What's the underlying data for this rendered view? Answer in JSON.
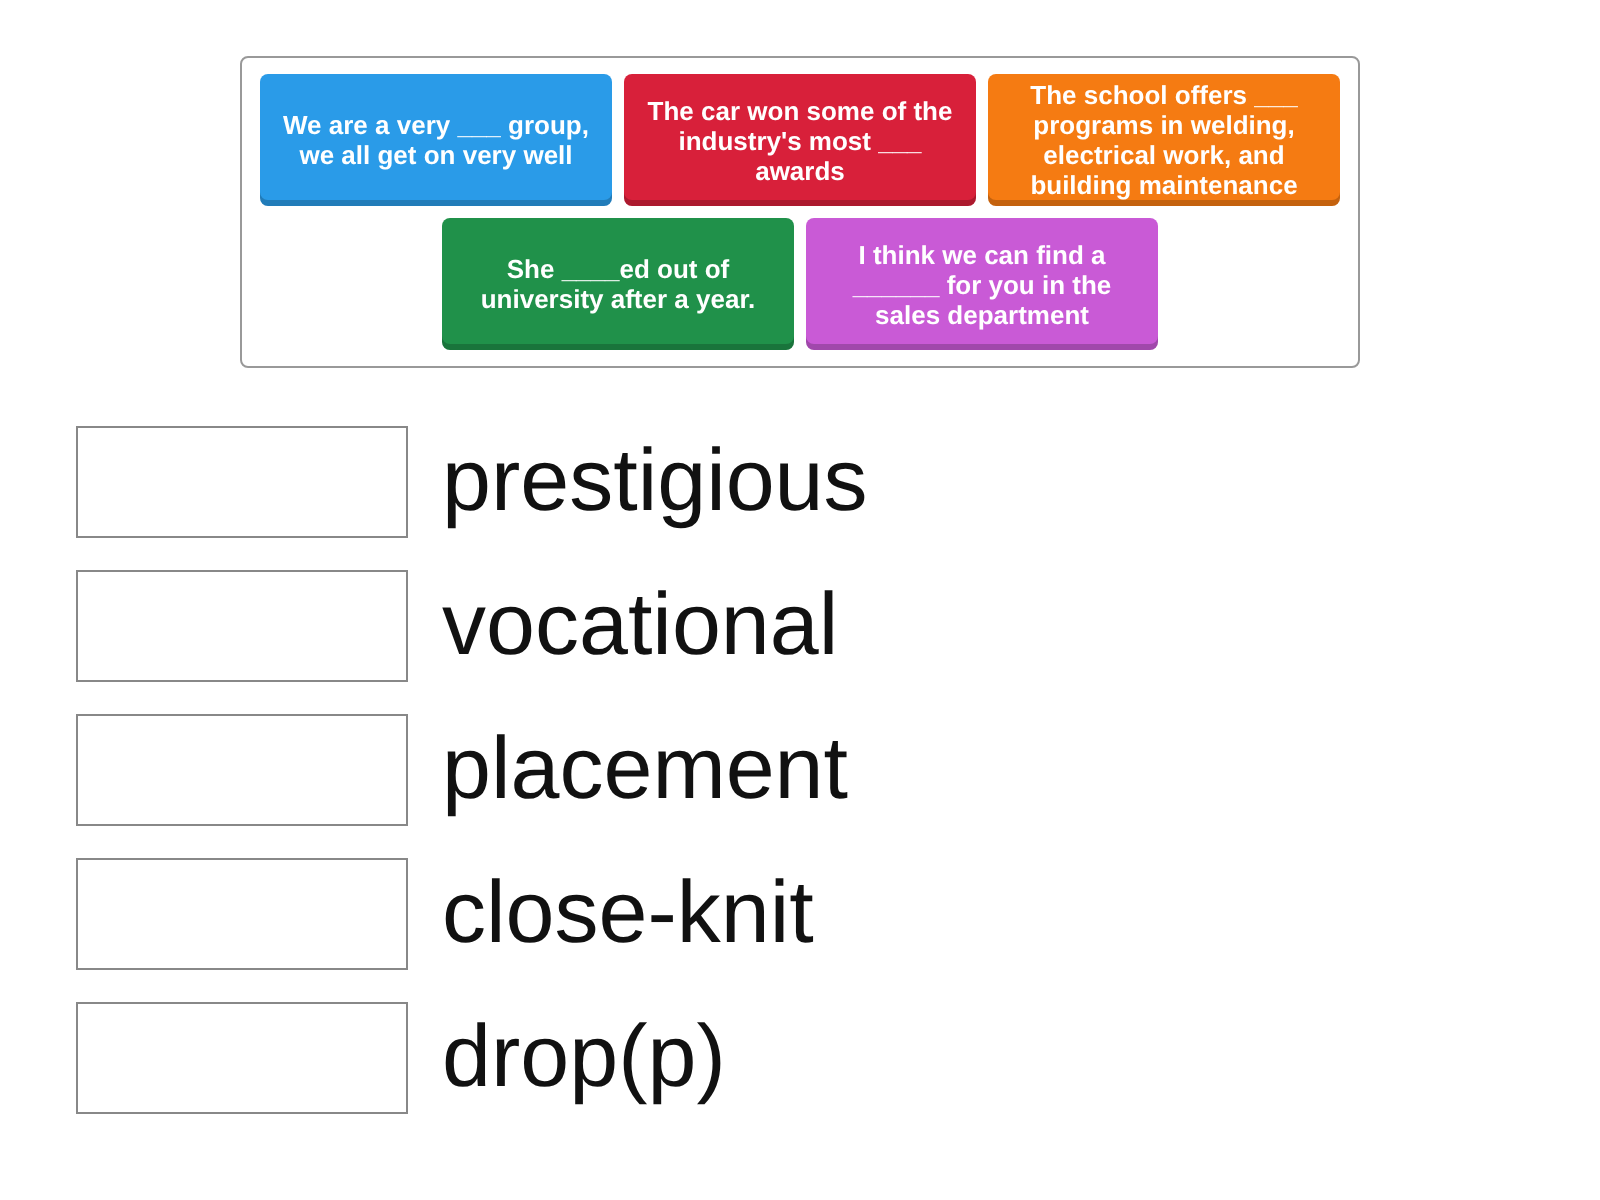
{
  "cards": [
    {
      "text": "We are a very ___ group, we all get on very well",
      "color": "#2a9be8"
    },
    {
      "text": "The car won some of the industry's most ___ awards",
      "color": "#d8203a"
    },
    {
      "text": "The school offers ___ programs in welding, electrical work, and building maintenance",
      "color": "#f57b12"
    },
    {
      "text": "She ____ed out of university after a year.",
      "color": "#20914a"
    },
    {
      "text": "I think we can find a ______ for you in the sales department",
      "color": "#c95ad6"
    }
  ],
  "answers": [
    {
      "word": "prestigious"
    },
    {
      "word": "vocational"
    },
    {
      "word": "placement"
    },
    {
      "word": "close-knit"
    },
    {
      "word": "drop(p)"
    }
  ]
}
